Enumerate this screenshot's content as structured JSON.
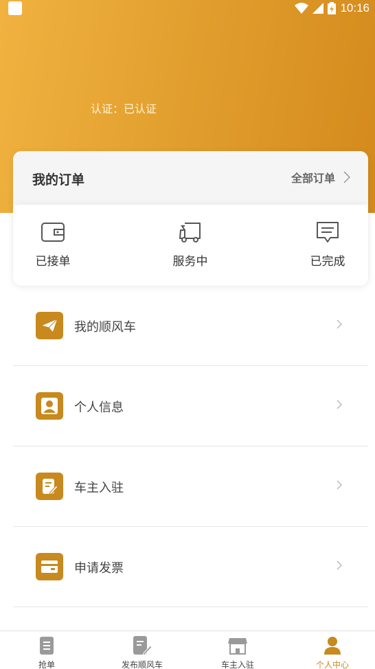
{
  "status_bar": {
    "time": "10:16"
  },
  "profile": {
    "certification": "认证：已认证"
  },
  "orders": {
    "title": "我的订单",
    "all_label": "全部订单",
    "items": [
      {
        "label": "已接单",
        "icon": "wallet-icon"
      },
      {
        "label": "服务中",
        "icon": "truck-icon"
      },
      {
        "label": "已完成",
        "icon": "message-icon"
      }
    ]
  },
  "menu": [
    {
      "label": "我的顺风车",
      "icon": "paper-plane-icon"
    },
    {
      "label": "个人信息",
      "icon": "user-icon"
    },
    {
      "label": "车主入驻",
      "icon": "edit-icon"
    },
    {
      "label": "申请发票",
      "icon": "card-icon"
    }
  ],
  "tabbar": [
    {
      "label": "抢单",
      "icon": "document-icon",
      "active": false
    },
    {
      "label": "发布顺风车",
      "icon": "document-edit-icon",
      "active": false
    },
    {
      "label": "车主入驻",
      "icon": "store-icon",
      "active": false
    },
    {
      "label": "个人中心",
      "icon": "person-icon",
      "active": true
    }
  ],
  "colors": {
    "accent": "#c8891e",
    "header_start": "#f1b240",
    "header_end": "#d48a1c"
  }
}
